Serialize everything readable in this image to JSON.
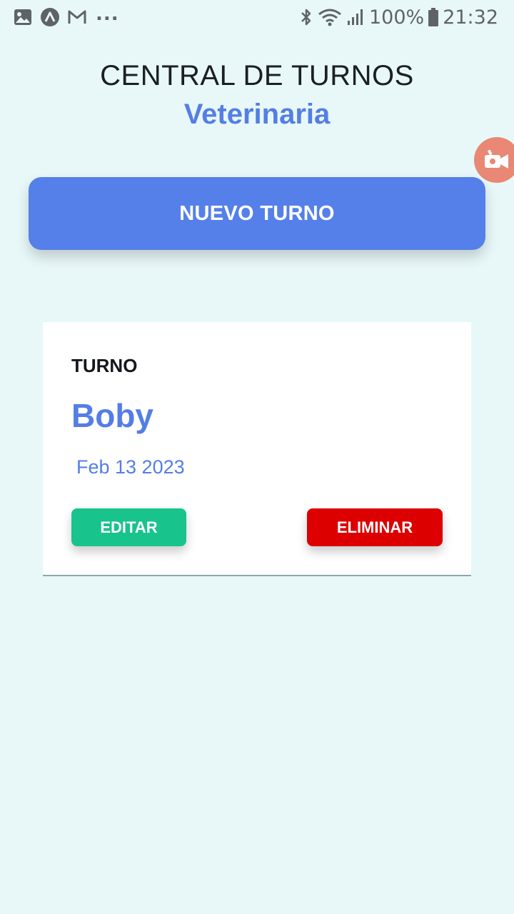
{
  "status_bar": {
    "left_icons": [
      "image-icon",
      "app-a-icon",
      "gmail-icon"
    ],
    "more": "...",
    "right_icons": [
      "bluetooth-icon",
      "wifi-icon",
      "signal-icon",
      "battery-icon"
    ],
    "battery": "100%",
    "time": "21:32"
  },
  "header": {
    "title": "CENTRAL DE TURNOS",
    "subtitle": "Veterinaria"
  },
  "record_bubble": {
    "icon": "camera-record-icon",
    "color": "#e8836f"
  },
  "new_button": {
    "label": "NUEVO TURNO",
    "color": "#5580e9"
  },
  "appointments": [
    {
      "label": "TURNO",
      "name": "Boby",
      "date": "Feb 13 2023",
      "edit_label": "EDITAR",
      "delete_label": "ELIMINAR"
    }
  ],
  "colors": {
    "background": "#e8f8f8",
    "accent": "#547ee6",
    "edit": "#18c48b",
    "delete": "#dd0000"
  }
}
